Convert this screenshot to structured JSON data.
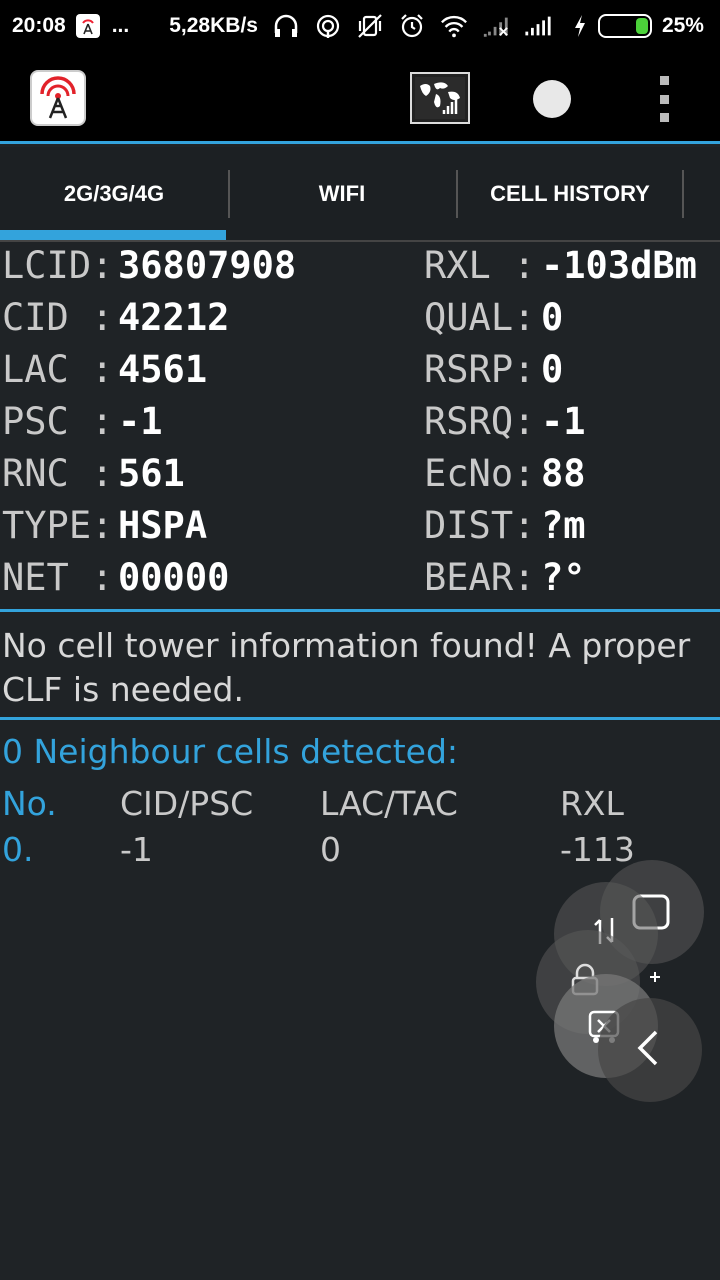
{
  "status_bar": {
    "time": "20:08",
    "dots": "...",
    "speed": "5,28KB/s",
    "battery": "25%",
    "icons": [
      "app-notification-icon",
      "headphones-icon",
      "hotspot-icon",
      "vibrate-off-icon",
      "alarm-icon",
      "wifi-icon",
      "signal-no-sim-icon",
      "signal-icon",
      "charging-icon",
      "battery-icon"
    ]
  },
  "app_bar": {
    "icons": [
      "app-logo-icon",
      "map-icon",
      "record-icon",
      "overflow-menu-icon"
    ]
  },
  "tabs": [
    {
      "label": "2G/3G/4G",
      "active": true
    },
    {
      "label": "WIFI",
      "active": false
    },
    {
      "label": "CELL HISTORY",
      "active": false
    }
  ],
  "info": {
    "left": [
      {
        "label": "LCID:",
        "value": "36807908"
      },
      {
        "label": "CID :",
        "value": "42212"
      },
      {
        "label": "LAC :",
        "value": "4561"
      },
      {
        "label": "PSC :",
        "value": "-1"
      },
      {
        "label": "RNC :",
        "value": "561"
      },
      {
        "label": "TYPE:",
        "value": "HSPA"
      },
      {
        "label": "NET :",
        "value": "00000"
      }
    ],
    "right": [
      {
        "label": "RXL :",
        "value": "-103dBm"
      },
      {
        "label": "QUAL:",
        "value": "0"
      },
      {
        "label": "RSRP:",
        "value": "0"
      },
      {
        "label": "RSRQ:",
        "value": "-1"
      },
      {
        "label": "EcNo:",
        "value": "88"
      },
      {
        "label": "DIST:",
        "value": "?m"
      },
      {
        "label": "BEAR:",
        "value": "?°"
      }
    ]
  },
  "message": "No cell tower information found! A proper CLF is needed.",
  "neighbours": {
    "title": "0 Neighbour cells detected:",
    "headers": [
      "No.",
      "CID/PSC",
      "LAC/TAC",
      "RXL"
    ],
    "rows": [
      [
        "0.",
        "-1",
        "0",
        "-113"
      ]
    ]
  },
  "colors": {
    "accent": "#33a3dc",
    "background": "#1f2326",
    "bar": "#000000"
  }
}
